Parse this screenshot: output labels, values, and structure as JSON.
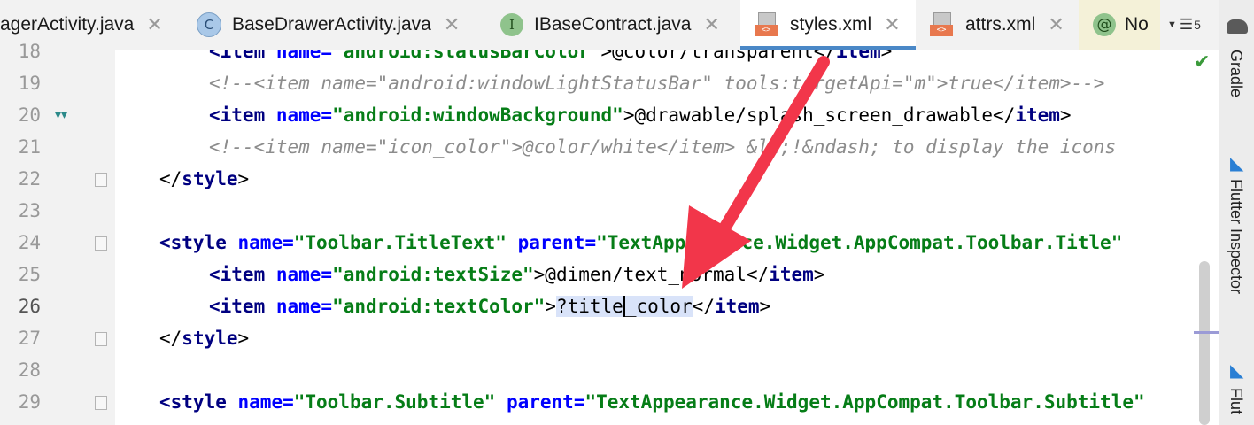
{
  "tabs": [
    {
      "label": "agerActivity.java",
      "icon": "java-class-icon"
    },
    {
      "label": "BaseDrawerActivity.java",
      "icon": "java-class-icon",
      "badge": "C"
    },
    {
      "label": "IBaseContract.java",
      "icon": "interface-icon",
      "badge": "I"
    },
    {
      "label": "styles.xml",
      "icon": "xml-file-icon",
      "active": true
    },
    {
      "label": "attrs.xml",
      "icon": "xml-file-icon"
    },
    {
      "label": "No",
      "icon": "annotation-icon",
      "badge": "@"
    }
  ],
  "tabs_more_count": "5",
  "close_glyph": "✕",
  "xml_badge": "<>",
  "right_panels": [
    "Gradle",
    "Flutter Inspector",
    "Flut"
  ],
  "line_numbers": [
    "18",
    "19",
    "20",
    "21",
    "22",
    "23",
    "24",
    "25",
    "26",
    "27",
    "28",
    "29"
  ],
  "current_line": "26",
  "code": {
    "l18": {
      "t1": "<item ",
      "a1": "name=",
      "v1": "\"android:statusBarColor\"",
      "t2": ">@color/transparent</",
      "t3": "item",
      "t4": ">"
    },
    "l19": {
      "c": "<!--<item name=\"android:windowLightStatusBar\" tools:targetApi=\"m\">true</item>-->"
    },
    "l20": {
      "t1": "<item ",
      "a1": "name=",
      "v1": "\"android:windowBackground\"",
      "t2": ">@drawable/splash_screen_drawable</",
      "t3": "item",
      "t4": ">"
    },
    "l21": {
      "c": "<!--<item name=\"icon_color\">@color/white</item> &lt;!&ndash; to display the icons"
    },
    "l22": {
      "t1": "</",
      "t2": "style",
      "t3": ">"
    },
    "l24": {
      "t1": "<style ",
      "a1": "name=",
      "v1": "\"Toolbar.TitleText\"",
      "a2": " parent=",
      "v2": "\"TextAppearance.Widget.AppCompat.Toolbar.Title\""
    },
    "l25": {
      "t1": "<item ",
      "a1": "name=",
      "v1": "\"android:textSize\"",
      "t2": ">@dimen/text_normal</",
      "t3": "item",
      "t4": ">"
    },
    "l26": {
      "t1": "<item ",
      "a1": "name=",
      "v1": "\"android:textColor\"",
      "t2": ">",
      "sel1": "?title",
      "sel2": "_color",
      "t3": "</",
      "t4": "item",
      "t5": ">"
    },
    "l27": {
      "t1": "</",
      "t2": "style",
      "t3": ">"
    },
    "l29": {
      "t1": "<style ",
      "a1": "name=",
      "v1": "\"Toolbar.Subtitle\"",
      "a2": " parent=",
      "v2": "\"TextAppearance.Widget.AppCompat.Toolbar.Subtitle\""
    }
  },
  "colors": {
    "tag": "#000080",
    "attr": "#0000ff",
    "value": "#067d17",
    "comment": "#8c8c8c",
    "annotation_arrow": "#f2364a"
  }
}
